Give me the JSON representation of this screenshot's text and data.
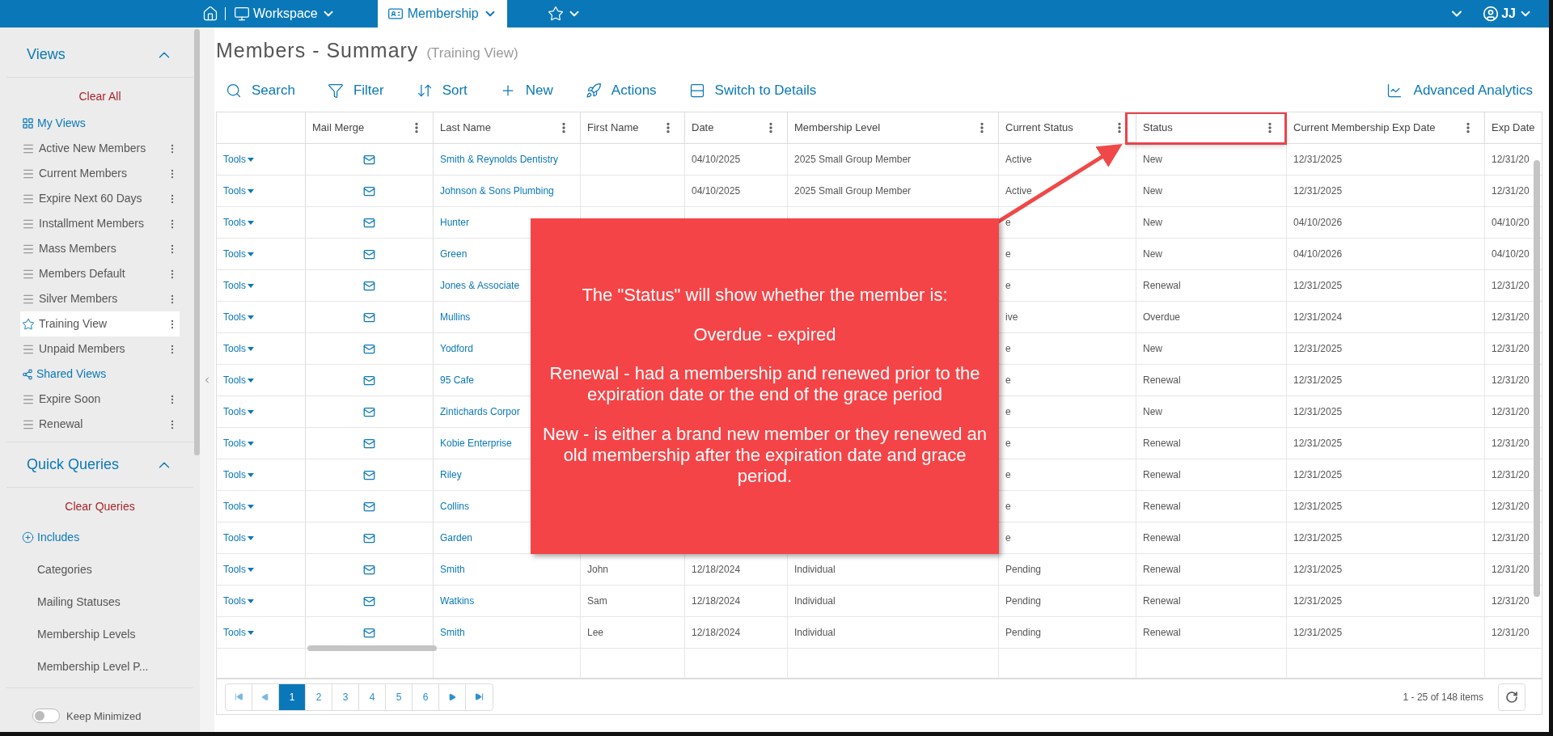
{
  "top_bar": {
    "workspace": "Workspace",
    "tabs": [
      {
        "label": "Membership",
        "selected": true
      }
    ],
    "user": "JJ"
  },
  "sidebar": {
    "views": {
      "title": "Views",
      "expanded": true,
      "clear": "Clear All",
      "items": [
        {
          "kind": "group",
          "label": "My Views"
        },
        {
          "kind": "view",
          "label": "Active New Members",
          "selected": false
        },
        {
          "kind": "view",
          "label": "Current Members",
          "selected": false
        },
        {
          "kind": "view",
          "label": "Expire Next 60 Days",
          "selected": false
        },
        {
          "kind": "view",
          "label": "Installment Members",
          "selected": false
        },
        {
          "kind": "view",
          "label": "Mass Members",
          "selected": false
        },
        {
          "kind": "view",
          "label": "Members Default",
          "selected": false
        },
        {
          "kind": "view",
          "label": "Silver Members",
          "selected": false
        },
        {
          "kind": "view",
          "label": "Training View",
          "selected": true
        },
        {
          "kind": "view",
          "label": "Unpaid Members",
          "selected": false
        },
        {
          "kind": "shared",
          "label": "Shared Views"
        },
        {
          "kind": "view",
          "label": "Expire Soon",
          "selected": false
        },
        {
          "kind": "view",
          "label": "Renewal",
          "selected": false
        }
      ]
    },
    "quick_queries": {
      "title": "Quick Queries",
      "expanded": true,
      "clear": "Clear Queries",
      "items": [
        {
          "kind": "add",
          "label": "Includes"
        },
        {
          "kind": "query",
          "label": "Categories"
        },
        {
          "kind": "query",
          "label": "Mailing Statuses"
        },
        {
          "kind": "query",
          "label": "Membership Levels"
        },
        {
          "kind": "query",
          "label": "Membership Level P..."
        }
      ]
    },
    "keep_minimized": {
      "label": "Keep Minimized",
      "on": false
    }
  },
  "page": {
    "title": "Members - Summary",
    "subtitle": "(Training View)",
    "toolbar": [
      "Search",
      "Filter",
      "Sort",
      "New",
      "Actions",
      "Switch to Details"
    ],
    "analytics": "Advanced Analytics"
  },
  "table": {
    "columns": [
      "Mail Merge",
      "Last Name",
      "First Name",
      "Date",
      "Membership Level",
      "Current Status",
      "Status",
      "Current Membership Exp Date",
      "Exp Date"
    ],
    "rows": [
      {
        "tools": "Tools",
        "last_name": "Smith & Reynolds Dentistry",
        "date": "04/10/2025",
        "level": "2025 Small Group Member",
        "current_status": "Active",
        "status": "New",
        "current_exp": "12/31/2025",
        "exp_date": "12/31/20"
      },
      {
        "tools": "Tools",
        "last_name": "Johnson & Sons Plumbing",
        "date": "04/10/2025",
        "level": "2025 Small Group Member",
        "current_status": "Active",
        "status": "New",
        "current_exp": "12/31/2025",
        "exp_date": "12/31/20"
      },
      {
        "tools": "Tools",
        "last_name": "Hunter",
        "current_status": "e",
        "status": "New",
        "current_exp": "04/10/2026",
        "exp_date": "04/10/20"
      },
      {
        "tools": "Tools",
        "last_name": "Green",
        "current_status": "e",
        "status": "New",
        "current_exp": "04/10/2026",
        "exp_date": "04/10/20"
      },
      {
        "tools": "Tools",
        "last_name": "Jones & Associate",
        "current_status": "e",
        "status": "Renewal",
        "current_exp": "12/31/2025",
        "exp_date": "12/31/20"
      },
      {
        "tools": "Tools",
        "last_name": "Mullins",
        "current_status": "ive",
        "status": "Overdue",
        "current_exp": "12/31/2024",
        "exp_date": "12/31/20"
      },
      {
        "tools": "Tools",
        "last_name": "Yodford",
        "current_status": "e",
        "status": "New",
        "current_exp": "12/31/2025",
        "exp_date": "12/31/20"
      },
      {
        "tools": "Tools",
        "last_name": "95 Cafe",
        "current_status": "e",
        "status": "Renewal",
        "current_exp": "12/31/2025",
        "exp_date": "12/31/20"
      },
      {
        "tools": "Tools",
        "last_name": "Zintichards Corpor",
        "current_status": "e",
        "status": "New",
        "current_exp": "12/31/2025",
        "exp_date": "12/31/20"
      },
      {
        "tools": "Tools",
        "last_name": "Kobie Enterprise",
        "current_status": "e",
        "status": "Renewal",
        "current_exp": "12/31/2025",
        "exp_date": "12/31/20"
      },
      {
        "tools": "Tools",
        "last_name": "Riley",
        "current_status": "e",
        "status": "Renewal",
        "current_exp": "12/31/2025",
        "exp_date": "12/31/20"
      },
      {
        "tools": "Tools",
        "last_name": "Collins",
        "current_status": "e",
        "status": "Renewal",
        "current_exp": "12/31/2025",
        "exp_date": "12/31/20"
      },
      {
        "tools": "Tools",
        "last_name": "Garden",
        "current_status": "e",
        "status": "Renewal",
        "current_exp": "12/31/2025",
        "exp_date": "12/31/20"
      },
      {
        "tools": "Tools",
        "last_name": "Smith",
        "first_name": "John",
        "date": "12/18/2024",
        "level": "Individual",
        "current_status": "Pending",
        "status": "Renewal",
        "current_exp": "12/31/2025",
        "exp_date": "12/31/20"
      },
      {
        "tools": "Tools",
        "last_name": "Watkins",
        "first_name": "Sam",
        "date": "12/18/2024",
        "level": "Individual",
        "current_status": "Pending",
        "status": "Renewal",
        "current_exp": "12/31/2025",
        "exp_date": "12/31/20"
      },
      {
        "tools": "Tools",
        "last_name": "Smith",
        "first_name": "Lee",
        "date": "12/18/2024",
        "level": "Individual",
        "current_status": "Pending",
        "status": "Renewal",
        "current_exp": "12/31/2025",
        "exp_date": "12/31/20"
      }
    ]
  },
  "callout": {
    "paragraphs": [
      "The \"Status\" will show whether the member is:",
      "Overdue - expired",
      "Renewal - had a membership and renewed prior to the expiration date or the end of the grace period",
      "New - is either a brand new member or they renewed an old membership after the expiration date and grace period."
    ]
  },
  "pager": {
    "pages": [
      {
        "label": "1",
        "selected": true
      },
      {
        "label": "2",
        "selected": false
      },
      {
        "label": "3",
        "selected": false
      },
      {
        "label": "4",
        "selected": false
      },
      {
        "label": "5",
        "selected": false
      },
      {
        "label": "6",
        "selected": false
      }
    ],
    "summary": "1 - 25 of 148 items"
  }
}
